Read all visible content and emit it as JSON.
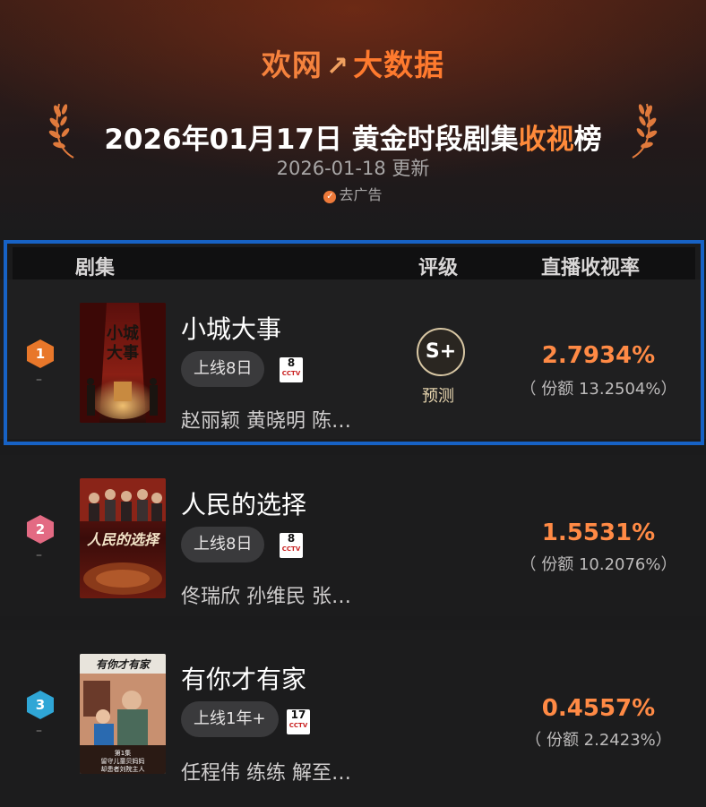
{
  "header": {
    "brand_part1": "欢网",
    "brand_part2": "↗",
    "brand_part3": "大数据",
    "title_main": "2026年01月17日 黄金时段剧集",
    "title_hl1": "收视",
    "title_hl2": "榜",
    "update": "2026-01-18 更新",
    "remove_ad": "去广告",
    "accent_color": "#ff8a3a"
  },
  "columns": {
    "drama": "剧集",
    "grade": "评级",
    "rating": "直播收视率"
  },
  "rows": [
    {
      "rank": "1",
      "rank_color": "#e8772a",
      "trend": "–",
      "name": "小城大事",
      "days": "上线8日",
      "channel": "8",
      "channel_brand": "CCTV",
      "cast": "赵丽颖 黄晓明 陈…",
      "grade": "S+",
      "grade_label": "预测",
      "rating": "2.7934%",
      "share": "（ 份额 13.2504%）",
      "poster_title": "小城大事"
    },
    {
      "rank": "2",
      "rank_color": "#e36a83",
      "trend": "–",
      "name": "人民的选择",
      "days": "上线8日",
      "channel": "8",
      "channel_brand": "CCTV",
      "cast": "佟瑞欣 孙维民 张…",
      "rating": "1.5531%",
      "share": "（ 份额 10.2076%）",
      "poster_title": "人民的选择"
    },
    {
      "rank": "3",
      "rank_color": "#2fa6d6",
      "trend": "–",
      "name": "有你才有家",
      "days": "上线1年+",
      "channel": "17",
      "channel_brand": "CCTV",
      "cast": "任程伟 练练 解至…",
      "rating": "0.4557%",
      "share": "（ 份额 2.2423%）",
      "poster_title": "有你才有家",
      "poster_caption_1": "第1集",
      "poster_caption_2": "留守儿童贝妈妈",
      "poster_caption_3": "却患者刘院主人"
    }
  ]
}
